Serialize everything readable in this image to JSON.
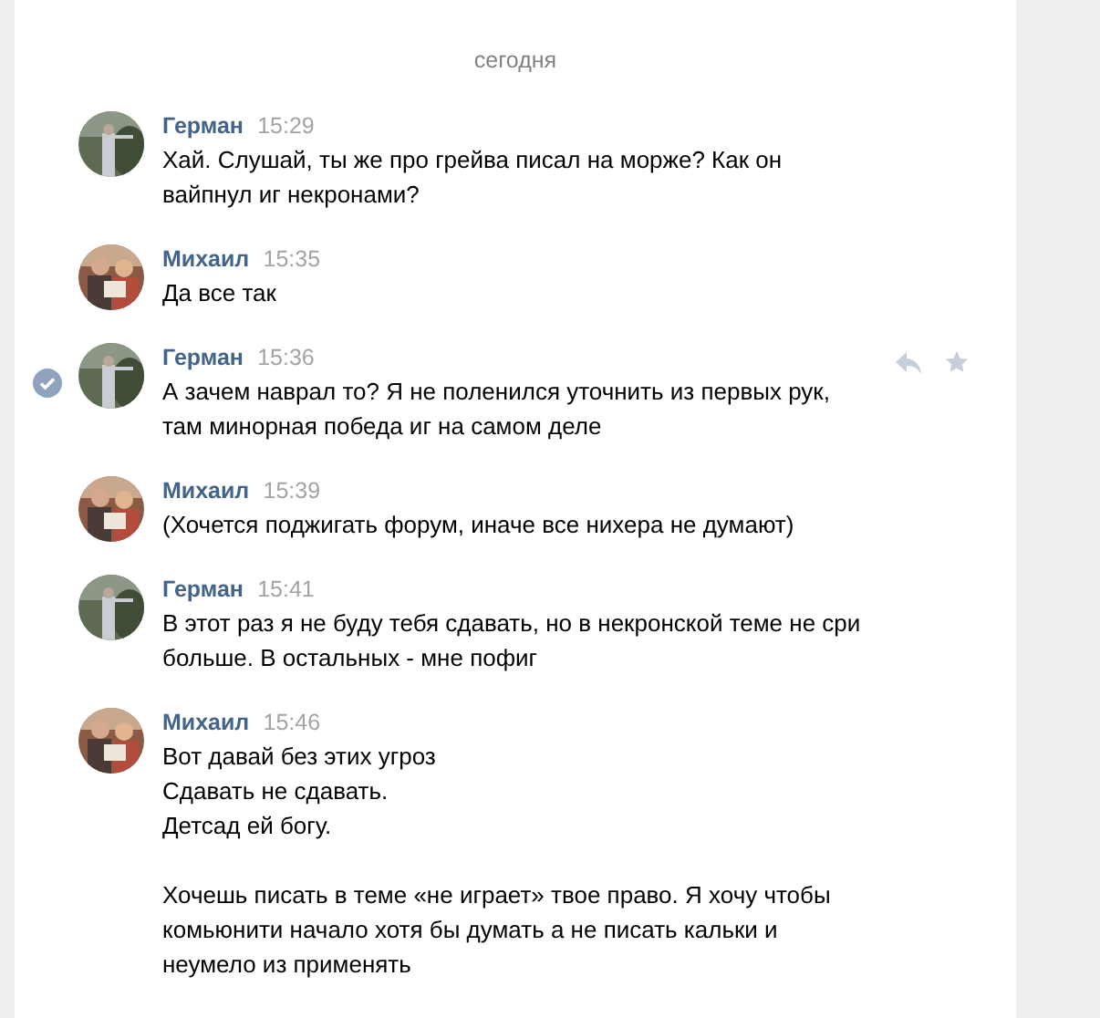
{
  "date_label": "сегодня",
  "messages": [
    {
      "author": "Герман",
      "time": "15:29",
      "text": "Хай. Слушай, ты же про грейва писал на морже? Как он\nвайпнул иг некронами?",
      "selected": false
    },
    {
      "author": "Михаил",
      "time": "15:35",
      "text": "Да все так",
      "selected": false
    },
    {
      "author": "Герман",
      "time": "15:36",
      "text": "А зачем наврал то? Я не поленился уточнить из первых рук,\nтам минорная победа иг на самом деле",
      "selected": true
    },
    {
      "author": "Михаил",
      "time": "15:39",
      "text": "(Хочется поджигать форум, иначе все нихера не думают)",
      "selected": false
    },
    {
      "author": "Герман",
      "time": "15:41",
      "text": "В этот раз я не буду тебя сдавать, но в некронской теме не сри\nбольше. В остальных - мне пофиг",
      "selected": false
    },
    {
      "author": "Михаил",
      "time": "15:46",
      "text": "Вот давай без этих угроз\nСдавать не сдавать.\nДетсад ей богу.\n\nХочешь писать в теме «не играет» твое право. Я хочу чтобы\nкомьюнити начало хотя бы думать а не писать кальки и\nнеумело из применять",
      "selected": false
    }
  ]
}
